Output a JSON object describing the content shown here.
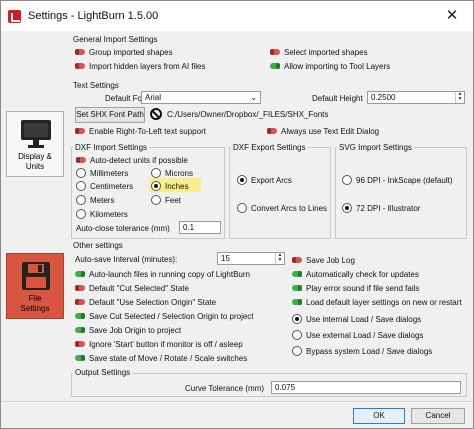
{
  "window": {
    "title": "Settings - LightBurn 1.5.00",
    "close": "✕"
  },
  "sidebar": {
    "display": {
      "label_1": "Display &",
      "label_2": "Units"
    },
    "file": {
      "label_1": "File",
      "label_2": "Settings"
    }
  },
  "general_import": {
    "title": "General Import Settings",
    "group_imported": {
      "label": "Group imported shapes",
      "on": false
    },
    "select_imported": {
      "label": "Select imported shapes",
      "on": false
    },
    "import_hidden": {
      "label": "Import hidden layers from AI files",
      "on": false
    },
    "allow_tool_layers": {
      "label": "Allow importing to Tool Layers",
      "on": true
    }
  },
  "text_settings": {
    "title": "Text Settings",
    "default_font_label": "Default Font",
    "default_font_value": "Arial",
    "default_height_label": "Default Height",
    "default_height_value": "0.2500",
    "shx_button": "Set SHX Font Path",
    "shx_path": "C:/Users/Owner/Dropbox/_FILES/SHX_Fonts",
    "rtl": {
      "label": "Enable Right-To-Left text support",
      "on": false
    },
    "always_edit": {
      "label": "Always use Text Edit Dialog",
      "on": false
    }
  },
  "dxf_import": {
    "title": "DXF Import Settings",
    "auto_detect": {
      "label": "Auto-detect units if possible",
      "on": false
    },
    "units": [
      {
        "label": "Millimeters",
        "selected": false
      },
      {
        "label": "Microns",
        "selected": false
      },
      {
        "label": "Centimeters",
        "selected": false
      },
      {
        "label": "Inches",
        "selected": true
      },
      {
        "label": "Meters",
        "selected": false
      },
      {
        "label": "Feet",
        "selected": false
      },
      {
        "label": "Kilometers",
        "selected": false
      }
    ],
    "auto_close_label": "Auto-close tolerance (mm)",
    "auto_close_value": "0.1"
  },
  "dxf_export": {
    "title": "DXF Export Settings",
    "export_arcs": {
      "label": "Export Arcs",
      "selected": true
    },
    "convert_arcs": {
      "label": "Convert Arcs to Lines",
      "selected": false
    }
  },
  "svg_import": {
    "title": "SVG Import Settings",
    "dpi_96": {
      "label": "96 DPI - InkScape (default)",
      "selected": false
    },
    "dpi_72": {
      "label": "72 DPI - Illustrator",
      "selected": true
    }
  },
  "other": {
    "title": "Other settings",
    "autosave_label": "Auto-save Interval (minutes):",
    "autosave_value": "15",
    "left": [
      {
        "label": "Auto-launch files in running copy of LightBurn",
        "on": true
      },
      {
        "label": "Default \"Cut Selected\" State",
        "on": false
      },
      {
        "label": "Default \"Use Selection Origin\" State",
        "on": false
      },
      {
        "label": "Save Cut Selected / Selection Origin to project",
        "on": true
      },
      {
        "label": "Save Job Origin to project",
        "on": true
      },
      {
        "label": "Ignore 'Start' button if monitor is off / asleep",
        "on": false
      },
      {
        "label": "Save state of Move / Rotate / Scale switches",
        "on": true
      }
    ],
    "right": [
      {
        "label": "Save Job Log",
        "on": false
      },
      {
        "label": "Automatically check for updates",
        "on": true
      },
      {
        "label": "Play error sound if file send fails",
        "on": true
      },
      {
        "label": "Load default layer settings on new or restart",
        "on": true
      }
    ],
    "dialogs": [
      {
        "label": "Use internal Load / Save dialogs",
        "selected": true
      },
      {
        "label": "Use external Load / Save dialogs",
        "selected": false
      },
      {
        "label": "Bypass system Load / Save dialogs",
        "selected": false
      }
    ]
  },
  "output": {
    "title": "Output Settings",
    "curve_label": "Curve Tolerance (mm)",
    "curve_value": "0.075"
  },
  "footer": {
    "ok": "OK",
    "cancel": "Cancel"
  },
  "colors": {
    "toggle_on": "#3fae49",
    "toggle_off": "#d9534f",
    "highlight": "#f7ef8d",
    "file_tab": "#d8563f"
  }
}
